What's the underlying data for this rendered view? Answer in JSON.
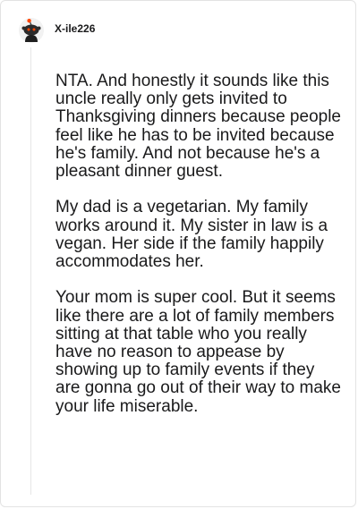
{
  "comment": {
    "author": "X-ile226",
    "avatar_icon": "reddit-snoo-avatar-icon",
    "paragraphs": [
      "NTA. And honestly it sounds like this uncle really only gets invited to Thanksgiving dinners because people feel like he has to be invited because he's family. And not because he's a pleasant dinner guest.",
      "My dad is a vegetarian. My family works around it. My sister in law is a vegan. Her side if the family happily accommodates her.",
      "Your mom is super cool. But it seems like there are a lot of family members sitting at that table who you really have no reason to appease by showing up to family events if they are gonna go out of their way to make your life miserable."
    ]
  },
  "colors": {
    "text": "#1a1a1b",
    "border": "#e3e3e3",
    "thread_line": "#e6e6e6",
    "avatar_accent": "#ff4500"
  }
}
